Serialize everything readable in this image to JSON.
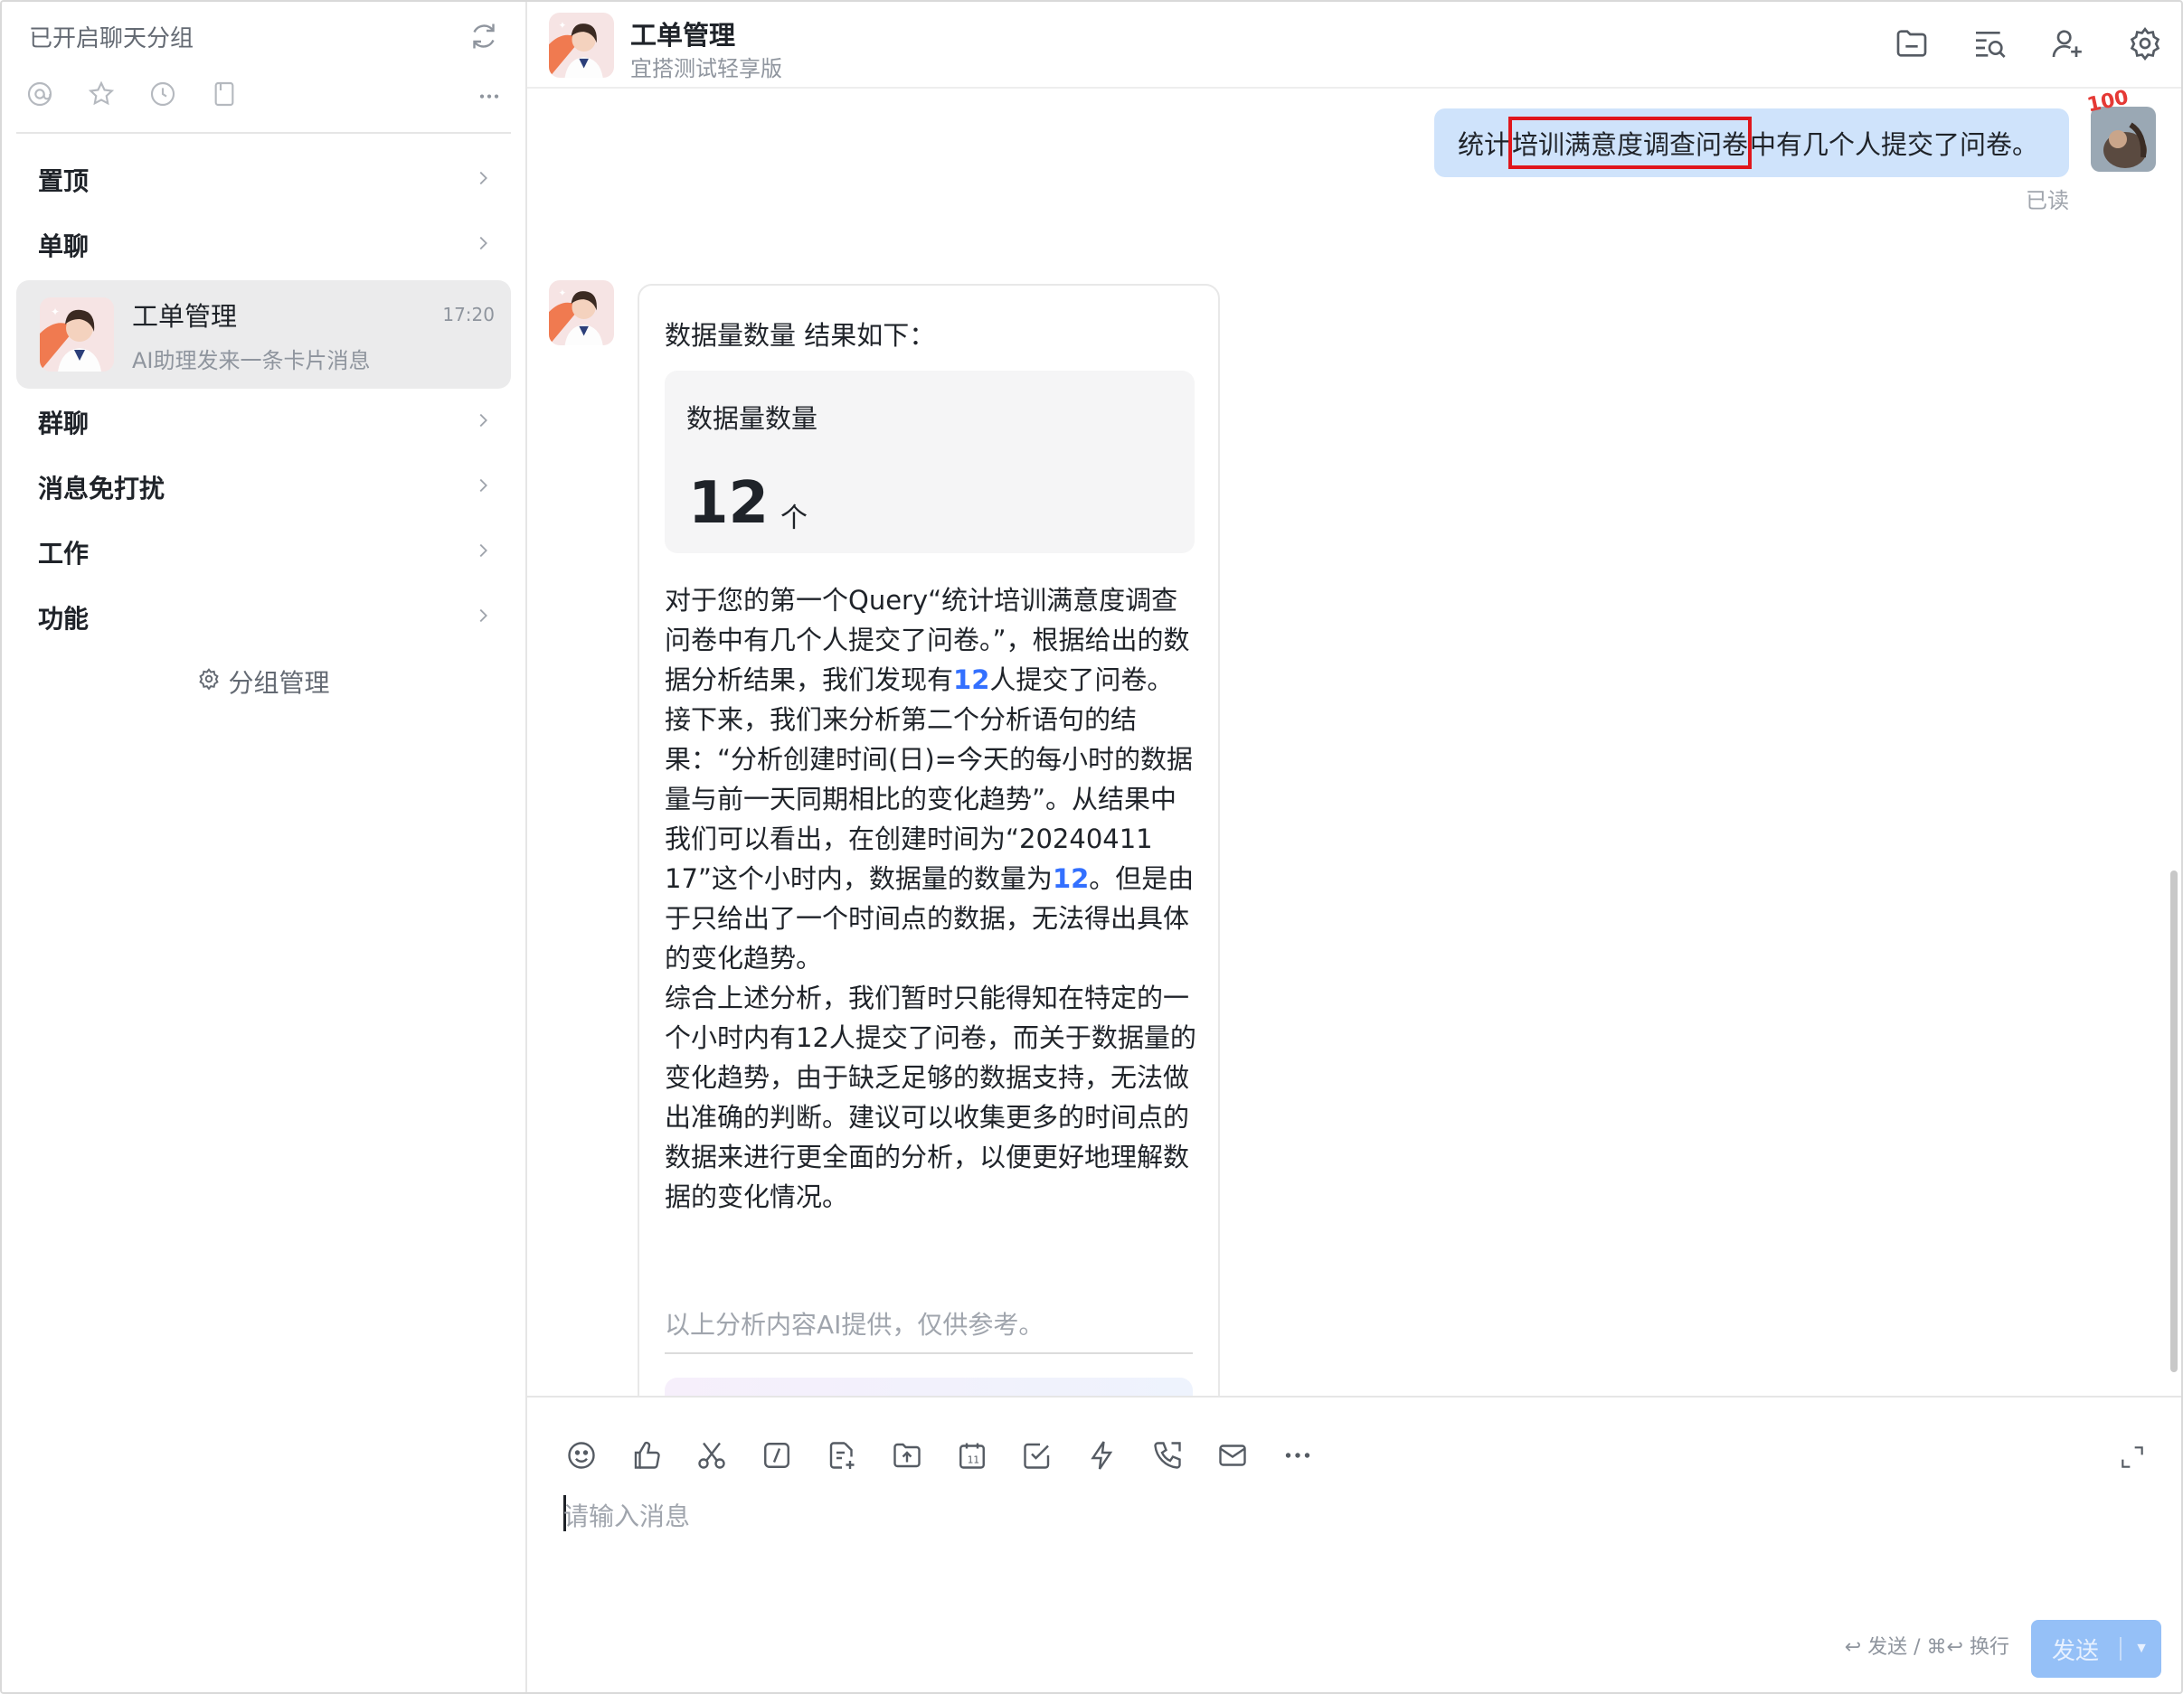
{
  "sidebar": {
    "title": "已开启聊天分组",
    "icons": [
      "mention-icon",
      "star-icon",
      "history-icon",
      "bookmark-icon",
      "more-icon"
    ],
    "groups": [
      {
        "label": "置顶"
      },
      {
        "label": "单聊"
      },
      {
        "label": "群聊"
      },
      {
        "label": "消息免打扰"
      },
      {
        "label": "工作"
      },
      {
        "label": "功能"
      }
    ],
    "active_conversation": {
      "name": "工单管理",
      "preview": "AI助理发来一条卡片消息",
      "time": "17:20"
    },
    "group_manage": "分组管理"
  },
  "header": {
    "title": "工单管理",
    "subtitle": "宜搭测试轻享版",
    "tools": [
      "folder-icon",
      "search-list-icon",
      "add-member-icon",
      "settings-icon"
    ]
  },
  "messages": {
    "user": {
      "prefix": "统计",
      "highlight": "培训满意度调查问卷",
      "suffix": "中有几个人提交了问卷。",
      "status": "已读",
      "avatar_badge": "100"
    },
    "bot_card": {
      "heading": "数据量数量 结果如下：",
      "metric_label": "数据量数量",
      "metric_value": "12",
      "metric_unit": "个",
      "p1_a": "对于您的第一个Query“统计培训满意度调查问卷中有几个人提交了问卷。”，根据给出的数据分析结果，我们发现有",
      "p1_num": "12",
      "p1_b": "人提交了问卷。",
      "p2_a": "接下来，我们来分析第二个分析语句的结果：“分析创建时间(日)=今天的每小时的数据量与前一天同期相比的变化趋势”。从结果中我们可以看出，在创建时间为“20240411 17”这个小时内，数据量的数量为",
      "p2_num": "12",
      "p2_b": "。但是由于只给出了一个时间点的数据，无法得出具体的变化趋势。",
      "p3": "综合上述分析，我们暂时只能得知在特定的一个小时内有12人提交了问卷，而关于数据量的变化趋势，由于缺乏足够的数据支持，无法做出准确的判断。建议可以收集更多的时间点的数据来进行更全面的分析，以便更好地理解数据的变化情况。",
      "disclaimer": "以上分析内容AI提供，仅供参考。"
    }
  },
  "composer": {
    "placeholder": "请输入消息",
    "value": "",
    "hint": "↩ 发送 / ⌘↩ 换行",
    "send_label": "发送",
    "tools": [
      "emoji-icon",
      "thumbs-up-icon",
      "scissors-icon",
      "slash-command-icon",
      "new-doc-icon",
      "upload-icon",
      "calendar-icon",
      "task-icon",
      "lightning-icon",
      "call-icon",
      "mail-icon",
      "more-icon"
    ]
  },
  "colors": {
    "accent": "#3370ff",
    "user_bubble": "#cfe3fb",
    "highlight_border": "#e0161c",
    "send_disabled": "#95c0f7"
  }
}
